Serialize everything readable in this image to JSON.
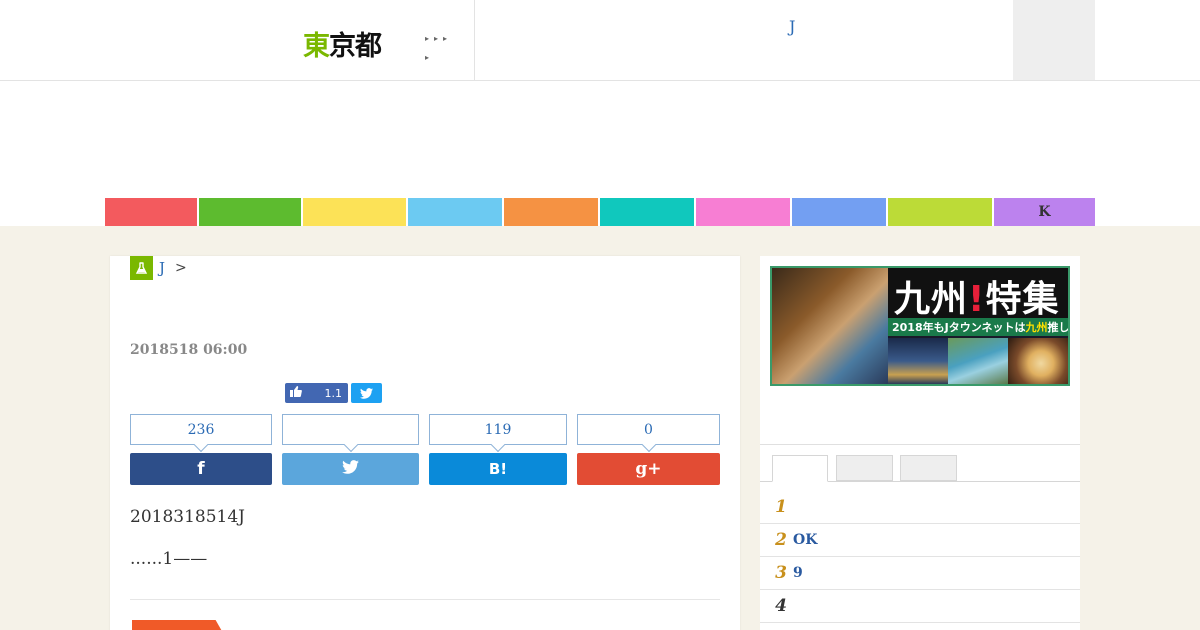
{
  "header": {
    "logo_highlight": "東",
    "logo_rest": "京都",
    "nav_dots_row1": "▸▸▸",
    "nav_dots_row2": "▸",
    "top_link": "J"
  },
  "category_bar": [
    {
      "label": "",
      "color": "#f35a5e"
    },
    {
      "label": "",
      "color": "#5dbb2f"
    },
    {
      "label": "",
      "color": "#fce257"
    },
    {
      "label": "",
      "color": "#6ccaf2"
    },
    {
      "label": "",
      "color": "#f59243"
    },
    {
      "label": "",
      "color": "#10c8bd"
    },
    {
      "label": "",
      "color": "#f77ed3"
    },
    {
      "label": "",
      "color": "#739ff2"
    },
    {
      "label": "",
      "color": "#bcdb37"
    },
    {
      "label": "K",
      "color": "#bc82ee"
    }
  ],
  "article": {
    "breadcrumb_link": "J",
    "breadcrumb_sep": ">",
    "date": "2018518 06:00",
    "fb_like_count": "1.1",
    "counts": {
      "facebook": "236",
      "twitter": "",
      "hatena": "119",
      "google": "0"
    },
    "share": {
      "facebook_icon": "f",
      "hatena_icon": "B!",
      "google_icon": "g+"
    },
    "body_line1": "2018318514J",
    "body_line2": "......1——"
  },
  "sidebar": {
    "banner": {
      "title_a": "九州",
      "title_mark": "!",
      "title_b": "特集",
      "sub_a": "2018年もJタウンネットは",
      "sub_hl": "九州",
      "sub_b": "推し!"
    },
    "rankings": [
      {
        "num": "1",
        "text": ""
      },
      {
        "num": "2",
        "text": "OK"
      },
      {
        "num": "3",
        "text": "9"
      },
      {
        "num": "4",
        "text": ""
      }
    ]
  },
  "colors": {
    "accent_green": "#7ab800",
    "link_blue": "#2a6ab4",
    "facebook": "#2d4e89",
    "twitter": "#5ba6dc",
    "hatena": "#0a8ad9",
    "google": "#e24c34",
    "page_bg": "#f5f2e8"
  }
}
